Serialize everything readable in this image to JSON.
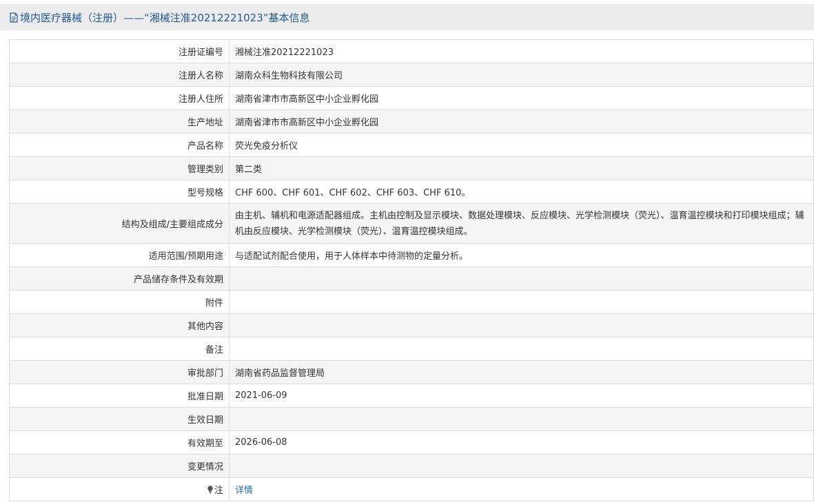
{
  "header": {
    "title": "境内医疗器械（注册）——“湘械注准20212221023”基本信息"
  },
  "rows": [
    {
      "label": "注册证编号",
      "value": "湘械注准20212221023"
    },
    {
      "label": "注册人名称",
      "value": "湖南众科生物科技有限公司"
    },
    {
      "label": "注册人住所",
      "value": "湖南省津市市高新区中小企业孵化园"
    },
    {
      "label": "生产地址",
      "value": "湖南省津市市高新区中小企业孵化园"
    },
    {
      "label": "产品名称",
      "value": "荧光免疫分析仪"
    },
    {
      "label": "管理类别",
      "value": "第二类"
    },
    {
      "label": "型号规格",
      "value": "CHF 600、CHF 601、CHF 602、CHF 603、CHF 610。"
    },
    {
      "label": "结构及组成/主要组成成分",
      "value": "由主机、辅机和电源适配器组成。主机由控制及显示模块、数据处理模块、反应模块、光学检测模块（荧光）、温育温控模块和打印模块组成；辅机由反应模块、光学检测模块（荧光）、温育温控模块组成。"
    },
    {
      "label": "适用范围/预期用途",
      "value": "与适配试剂配合使用，用于人体样本中待测物的定量分析。"
    },
    {
      "label": "产品储存条件及有效期",
      "value": ""
    },
    {
      "label": "附件",
      "value": ""
    },
    {
      "label": "其他内容",
      "value": ""
    },
    {
      "label": "备注",
      "value": ""
    },
    {
      "label": "审批部门",
      "value": "湖南省药品监督管理局"
    },
    {
      "label": "批准日期",
      "value": "2021-06-09"
    },
    {
      "label": "生效日期",
      "value": ""
    },
    {
      "label": "有效期至",
      "value": "2026-06-08"
    },
    {
      "label": "变更情况",
      "value": ""
    }
  ],
  "note_row": {
    "label": "注",
    "icon": "lightbulb-icon",
    "link_text": "详情"
  },
  "colors": {
    "title_text": "#1e5a96",
    "link": "#1e6fb8",
    "title_bar_bg": "#ececec",
    "alt_row_bg": "#f5f5f5"
  }
}
